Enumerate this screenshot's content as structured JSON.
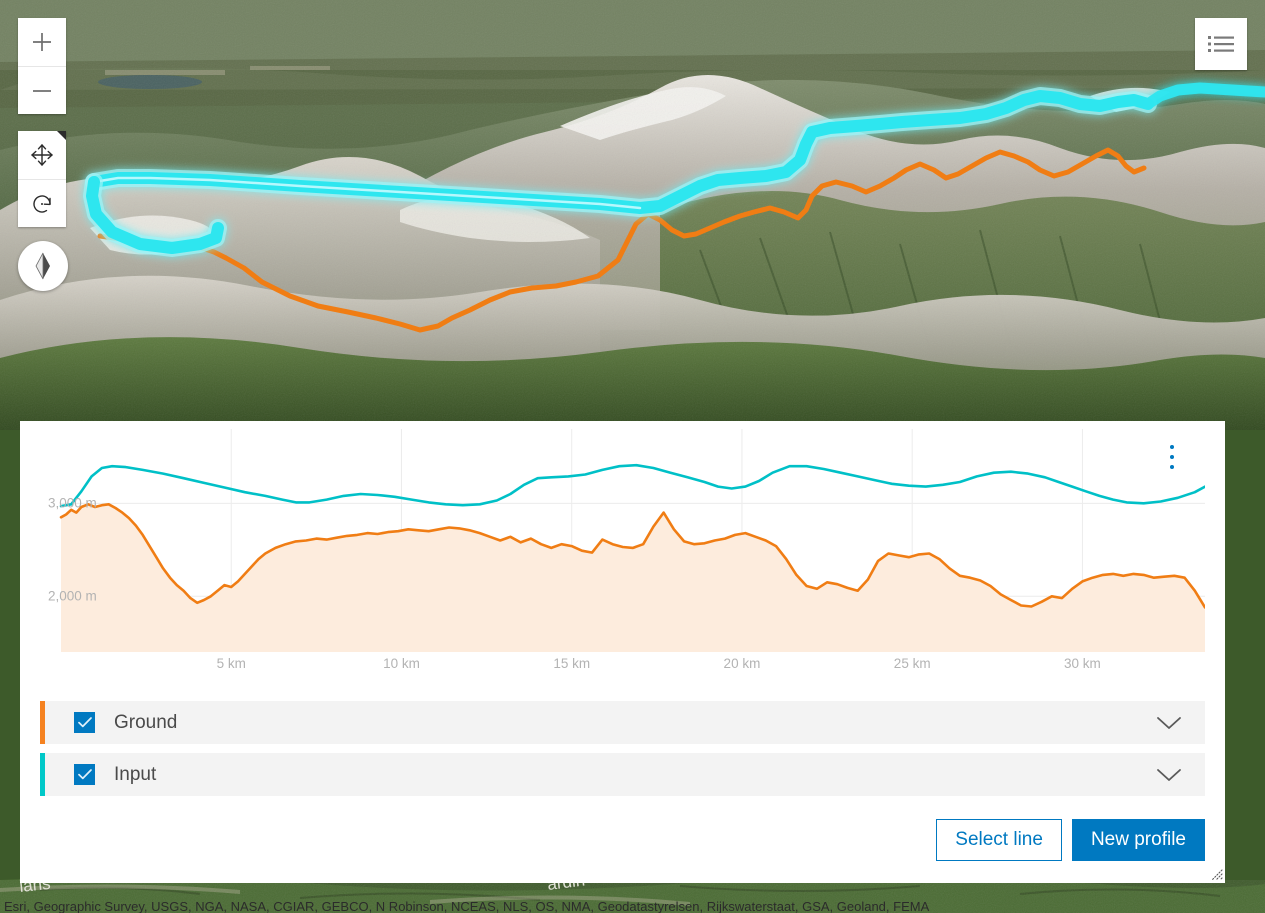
{
  "map": {
    "controls": {
      "zoom_in_label": "+",
      "zoom_out_label": "−",
      "pan_name": "pan-tool",
      "rotate_name": "rotate-tool",
      "compass_name": "compass",
      "legend_toggle_name": "layer-list-toggle"
    },
    "routes": {
      "input_line_color": "#2ee6ef",
      "ground_line_color": "#f07d14"
    }
  },
  "profile": {
    "menu_label": "⋮",
    "legend": {
      "rows": [
        {
          "label": "Ground",
          "color": "#f58220",
          "checked": true,
          "expand_icon": "chevron-down-icon"
        },
        {
          "label": "Input",
          "color": "#00c8c8",
          "checked": true,
          "expand_icon": "chevron-down-icon"
        }
      ]
    },
    "actions": {
      "select_line_label": "Select line",
      "new_profile_label": "New profile"
    }
  },
  "attribution": {
    "text": "Esri, Geographic Survey, USGS, NGA, NASA, CGIAR, GEBCO, N Robinson, NCEAS, NLS, OS, NMA, Geodatastyrelsen, Rijkswaterstaat, GSA, Geoland, FEMA"
  },
  "chart_data": {
    "type": "area",
    "title": "",
    "xlabel": "",
    "ylabel": "",
    "xlim": [
      0,
      33.6
    ],
    "ylim": [
      1400,
      3800
    ],
    "grid": true,
    "legend_position": "below",
    "x_ticks": [
      5,
      10,
      15,
      20,
      25,
      30
    ],
    "x_tick_labels": [
      "5 km",
      "10 km",
      "15 km",
      "20 km",
      "25 km",
      "30 km"
    ],
    "y_ticks": [
      2000,
      3000
    ],
    "y_tick_labels": [
      "2,000 m",
      "3,000 m"
    ],
    "series": [
      {
        "name": "Input",
        "color": "#00c0c7",
        "fill": false,
        "x": [
          0,
          0.3,
          0.6,
          0.9,
          1.2,
          1.5,
          1.9,
          2.4,
          3.0,
          3.6,
          4.2,
          4.8,
          5.4,
          6.0,
          6.5,
          6.9,
          7.3,
          7.8,
          8.3,
          8.8,
          9.3,
          9.8,
          10.3,
          10.8,
          11.3,
          11.8,
          12.3,
          12.8,
          13.2,
          13.6,
          14.0,
          14.4,
          14.9,
          15.4,
          15.9,
          16.4,
          16.9,
          17.4,
          17.9,
          18.4,
          18.9,
          19.3,
          19.7,
          20.1,
          20.5,
          20.9,
          21.4,
          21.9,
          22.4,
          22.9,
          23.4,
          23.9,
          24.4,
          24.9,
          25.4,
          25.9,
          26.4,
          26.9,
          27.4,
          27.9,
          28.4,
          28.9,
          29.3,
          29.7,
          30.1,
          30.5,
          30.9,
          31.3,
          31.8,
          32.3,
          32.8,
          33.3,
          33.6
        ],
        "y": [
          2970,
          2990,
          3130,
          3290,
          3380,
          3400,
          3390,
          3360,
          3320,
          3270,
          3220,
          3170,
          3120,
          3080,
          3040,
          3010,
          3010,
          3040,
          3080,
          3100,
          3090,
          3070,
          3040,
          3010,
          2990,
          2980,
          2990,
          3030,
          3100,
          3200,
          3270,
          3280,
          3290,
          3310,
          3360,
          3400,
          3410,
          3380,
          3330,
          3280,
          3230,
          3180,
          3160,
          3180,
          3240,
          3330,
          3400,
          3400,
          3370,
          3330,
          3290,
          3250,
          3210,
          3190,
          3180,
          3200,
          3230,
          3290,
          3330,
          3340,
          3320,
          3280,
          3230,
          3180,
          3130,
          3080,
          3040,
          3010,
          3000,
          3020,
          3060,
          3120,
          3180
        ]
      },
      {
        "name": "Ground",
        "color": "#f07d14",
        "fill": true,
        "fill_color": "#fdecdd",
        "x": [
          0,
          0.15,
          0.3,
          0.45,
          0.6,
          0.8,
          1.0,
          1.2,
          1.4,
          1.6,
          1.8,
          2.0,
          2.2,
          2.4,
          2.6,
          2.8,
          3.0,
          3.2,
          3.4,
          3.6,
          3.8,
          4.0,
          4.2,
          4.4,
          4.6,
          4.8,
          5.0,
          5.2,
          5.4,
          5.6,
          5.8,
          6.0,
          6.3,
          6.6,
          6.9,
          7.2,
          7.5,
          7.8,
          8.1,
          8.4,
          8.7,
          9.0,
          9.3,
          9.6,
          9.9,
          10.2,
          10.5,
          10.8,
          11.1,
          11.4,
          11.7,
          12.0,
          12.3,
          12.6,
          12.9,
          13.2,
          13.5,
          13.8,
          14.1,
          14.4,
          14.7,
          15.0,
          15.3,
          15.6,
          15.9,
          16.2,
          16.5,
          16.8,
          17.1,
          17.4,
          17.7,
          18.0,
          18.3,
          18.6,
          18.9,
          19.2,
          19.5,
          19.8,
          20.1,
          20.4,
          20.7,
          21.0,
          21.3,
          21.6,
          21.9,
          22.2,
          22.5,
          22.8,
          23.1,
          23.4,
          23.7,
          24.0,
          24.3,
          24.6,
          24.9,
          25.2,
          25.5,
          25.8,
          26.1,
          26.4,
          26.7,
          27.0,
          27.3,
          27.6,
          27.9,
          28.2,
          28.5,
          28.8,
          29.1,
          29.4,
          29.7,
          30.0,
          30.3,
          30.6,
          30.9,
          31.2,
          31.5,
          31.8,
          32.1,
          32.4,
          32.7,
          33.0,
          33.3,
          33.6
        ],
        "y": [
          2850,
          2880,
          2930,
          2900,
          2960,
          2990,
          2960,
          2980,
          2990,
          2950,
          2900,
          2840,
          2760,
          2660,
          2540,
          2420,
          2300,
          2200,
          2120,
          2060,
          1980,
          1930,
          1960,
          2000,
          2060,
          2120,
          2100,
          2160,
          2240,
          2320,
          2400,
          2460,
          2520,
          2560,
          2590,
          2600,
          2620,
          2610,
          2630,
          2650,
          2660,
          2680,
          2670,
          2690,
          2700,
          2720,
          2710,
          2700,
          2720,
          2740,
          2730,
          2710,
          2680,
          2640,
          2600,
          2640,
          2580,
          2620,
          2560,
          2520,
          2560,
          2540,
          2490,
          2470,
          2610,
          2560,
          2530,
          2520,
          2560,
          2750,
          2900,
          2720,
          2590,
          2560,
          2570,
          2600,
          2620,
          2660,
          2680,
          2640,
          2600,
          2540,
          2400,
          2230,
          2110,
          2080,
          2150,
          2130,
          2090,
          2060,
          2180,
          2380,
          2460,
          2440,
          2420,
          2450,
          2460,
          2400,
          2300,
          2220,
          2200,
          2170,
          2110,
          2020,
          1960,
          1900,
          1890,
          1940,
          2000,
          1980,
          2080,
          2160,
          2200,
          2230,
          2240,
          2220,
          2240,
          2230,
          2200,
          2210,
          2220,
          2200,
          2060,
          1880
        ]
      }
    ]
  }
}
